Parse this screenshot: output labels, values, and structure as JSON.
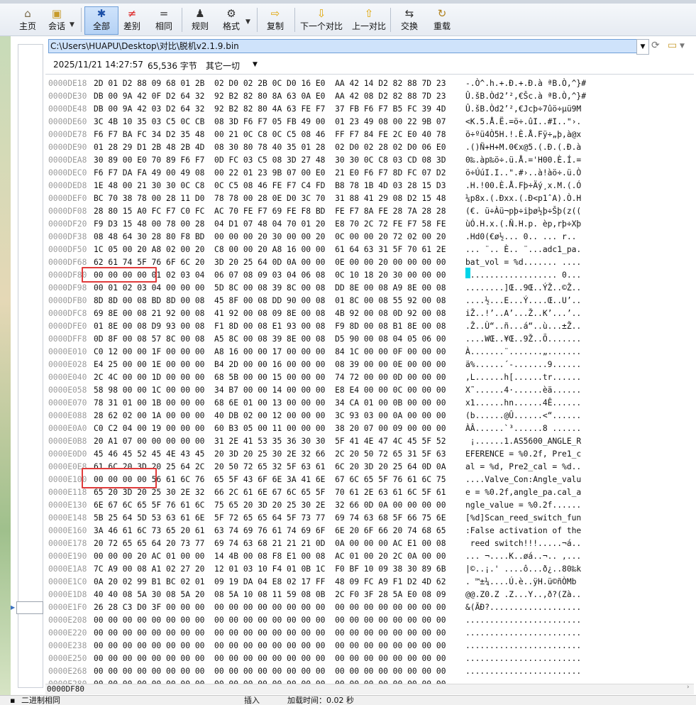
{
  "toolbar": {
    "buttons": [
      {
        "id": "home",
        "label": "主页",
        "icon": "house-icon",
        "glyph": "⌂"
      },
      {
        "id": "session",
        "label": "会话",
        "icon": "briefcase-icon",
        "glyph": "▣"
      },
      {
        "id": "all",
        "label": "全部",
        "icon": "asterisk-icon",
        "glyph": "✱"
      },
      {
        "id": "diff",
        "label": "差别",
        "icon": "not-equal-icon",
        "glyph": "≠"
      },
      {
        "id": "same",
        "label": "相同",
        "icon": "equal-icon",
        "glyph": "="
      },
      {
        "id": "rules",
        "label": "规则",
        "icon": "person-icon",
        "glyph": "♟"
      },
      {
        "id": "format",
        "label": "格式",
        "icon": "gear-icon",
        "glyph": "⚙"
      },
      {
        "id": "copy",
        "label": "复制",
        "icon": "arrow-right-icon",
        "glyph": "⇨"
      },
      {
        "id": "next",
        "label": "下一个对比",
        "icon": "arrow-down-icon",
        "glyph": "⇩"
      },
      {
        "id": "prev",
        "label": "上一对比",
        "icon": "arrow-up-icon",
        "glyph": "⇧"
      },
      {
        "id": "swap",
        "label": "交换",
        "icon": "swap-icon",
        "glyph": "⇆"
      },
      {
        "id": "reload",
        "label": "重载",
        "icon": "reload-icon",
        "glyph": "↻"
      }
    ]
  },
  "path": {
    "value": "C:\\Users\\HUAPU\\Desktop\\对比\\脱机v2.1.9.bin"
  },
  "info": {
    "datetime": "2025/11/21 14:27:57",
    "size": "65,536 字节",
    "other": "其它一切"
  },
  "status": {
    "offset": "0000DF80",
    "mode": "二进制相同",
    "insert": "插入",
    "load_time": "加载时间：0.02 秒"
  },
  "colors": {
    "highlight": "#e03b3b",
    "cursor": "#00d4e8",
    "path_bg": "#cfe3fb"
  },
  "rows": [
    {
      "addr": "0000DE18",
      "hex": "2D 01 D2 88 09 68 01 2B  02 D0 02 2B 0C D0 16 E0  AA 42 14 D2 82 88 7D 23",
      "ascii": "-.Ò^.h.+.Ð.+.Ð.à ªB.Ò,^}#"
    },
    {
      "addr": "0000DE30",
      "hex": "DB 00 9A 42 0F D2 64 32  92 B2 82 80 8A 63 0A E0  AA 42 08 D2 82 88 7D 23",
      "ascii": "Û.šB.Òd2’²,€Šc.à ªB.Ò,^}#"
    },
    {
      "addr": "0000DE48",
      "hex": "DB 00 9A 42 03 D2 64 32  92 B2 82 80 4A 63 FE F7  37 FB F6 F7 B5 FC 39 4D",
      "ascii": "Û.šB.Òd2’²,€Jcþ÷7ûö÷µü9M"
    },
    {
      "addr": "0000DE60",
      "hex": "3C 4B 10 35 03 C5 0C CB  08 3D F6 F7 05 FB 49 00  01 23 49 08 00 22 9B 07",
      "ascii": "<K.5.Å.Ë.=ö÷.ûI..#I..\"›."
    },
    {
      "addr": "0000DE78",
      "hex": "F6 F7 BA FC 34 D2 35 48  00 21 0C C8 0C C5 08 46  FF F7 84 FE 2C E0 40 78",
      "ascii": "ö÷ºü4Ò5H.!.È.Å.Fÿ÷„þ,à@x"
    },
    {
      "addr": "0000DE90",
      "hex": "01 28 29 D1 2B 48 2B 4D  08 30 80 78 40 35 01 28  02 D0 02 28 02 D0 06 E0",
      "ascii": ".()Ñ+H+M.0€x@5.(.Ð.(.Ð.à"
    },
    {
      "addr": "0000DEA8",
      "hex": "30 89 00 E0 70 89 F6 F7  0D FC 03 C5 08 3D 27 48  30 30 0C C8 03 CD 08 3D",
      "ascii": "0‰.àp‰ö÷.ü.Å.='H00.È.Í.="
    },
    {
      "addr": "0000DEC0",
      "hex": "F6 F7 DA FA 49 00 49 08  00 22 01 23 9B 07 00 E0  21 E0 F6 F7 8D FC 07 D2",
      "ascii": "ö÷ÚúI.I..\".#›..à!àö÷.ü.Ò"
    },
    {
      "addr": "0000DED8",
      "hex": "1E 48 00 21 30 30 0C C8  0C C5 08 46 FE F7 C4 FD  B8 78 1B 4D 03 28 15 D3",
      "ascii": ".H.!00.È.Å.Fþ÷Äý¸x.M.(.Ó"
    },
    {
      "addr": "0000DEF0",
      "hex": "BC 70 38 78 00 28 11 D0  78 78 00 28 0E D0 3C 70  31 88 41 29 08 D2 15 48",
      "ascii": "¼p8x.(.Ðxx.(.Ð<p1ˆA).Ò.H"
    },
    {
      "addr": "0000DF08",
      "hex": "28 80 15 A0 FC F7 C0 FC  AC 70 FE F7 69 FE F8 BD  FE F7 8A FE 28 7A 28 28",
      "ascii": "(€. ü÷Àü¬pþ÷iþø½þ÷Šþ(z(("
    },
    {
      "addr": "0000DF20",
      "hex": "F9 D3 15 48 00 78 00 28  04 D1 07 48 04 70 01 20  E8 70 2C 72 FE F7 58 FE",
      "ascii": "ùÓ.H.x.(.Ñ.H.p. èp,rþ÷Xþ"
    },
    {
      "addr": "0000DF38",
      "hex": "08 48 64 30 28 80 F8 BD  00 00 00 20 30 00 00 20  0C 00 00 20 72 02 00 20",
      "ascii": ".Hd0(€ø½... 0.. ... r.. "
    },
    {
      "addr": "0000DF50",
      "hex": "1C 05 00 20 A8 02 00 20  C8 00 00 20 A8 16 00 00  61 64 63 31 5F 70 61 2E",
      "ascii": "... ¨.. È.. ¨...adc1_pa."
    },
    {
      "addr": "0000DF68",
      "hex": "62 61 74 5F 76 6F 6C 20  3D 20 25 64 0D 0A 00 00  0E 00 00 20 00 00 00 00",
      "ascii": "bat_vol = %d....... ...."
    },
    {
      "addr": "0000DF80",
      "hex": "00 00 00 00 01 02 03 04  06 07 08 09 03 04 06 08  0C 10 18 20 30 00 00 00",
      "ascii": "................... 0..."
    },
    {
      "addr": "0000DF98",
      "hex": "00 01 02 03 04 00 00 00  5D 8C 00 08 39 8C 00 08  DD 8E 00 08 A9 8E 00 08",
      "ascii": "........]Œ..9Œ..ÝŽ..©Ž.."
    },
    {
      "addr": "0000DFB0",
      "hex": "8D 8D 00 08 BD 8D 00 08  45 8F 00 08 DD 90 00 08  01 8C 00 08 55 92 00 08",
      "ascii": "....½...E...Ý....Œ..U’.."
    },
    {
      "addr": "0000DFC8",
      "hex": "69 8E 00 08 21 92 00 08  41 92 00 08 09 8E 00 08  4B 92 00 08 0D 92 00 08",
      "ascii": "iŽ..!’..A’...Ž..K’...’.."
    },
    {
      "addr": "0000DFE0",
      "hex": "01 8E 00 08 D9 93 00 08  F1 8D 00 08 E1 93 00 08  F9 8D 00 08 B1 8E 00 08",
      "ascii": ".Ž..Ù“..ñ...á“..ù...±Ž.."
    },
    {
      "addr": "0000DFF8",
      "hex": "0D 8F 00 08 57 8C 00 08  A5 8C 00 08 39 8E 00 08  D5 90 00 08 04 05 06 00",
      "ascii": "....WŒ..¥Œ..9Ž..Õ......."
    },
    {
      "addr": "0000E010",
      "hex": "C0 12 00 00 1F 00 00 00  A8 16 00 00 17 00 00 00  84 1C 00 00 0F 00 00 00",
      "ascii": "À.......¨.......„......."
    },
    {
      "addr": "0000E028",
      "hex": "E4 25 00 00 1E 00 00 00  B4 2D 00 00 16 00 00 00  08 39 00 00 0E 00 00 00",
      "ascii": "ä%......´-.......9......"
    },
    {
      "addr": "0000E040",
      "hex": "2C 4C 00 00 1D 00 00 00  68 5B 00 00 15 00 00 00  74 72 00 00 0D 00 00 00",
      "ascii": ",L......h[......tr......"
    },
    {
      "addr": "0000E058",
      "hex": "58 98 00 00 1C 00 00 00  34 B7 00 00 14 00 00 00  E8 E4 00 00 0C 00 00 00",
      "ascii": "X˜......4·......èä......"
    },
    {
      "addr": "0000E070",
      "hex": "78 31 01 00 1B 00 00 00  68 6E 01 00 13 00 00 00  34 CA 01 00 0B 00 00 00",
      "ascii": "x1......hn......4Ê......"
    },
    {
      "addr": "0000E088",
      "hex": "28 62 02 00 1A 00 00 00  40 DB 02 00 12 00 00 00  3C 93 03 00 0A 00 00 00",
      "ascii": "(b......@Û......<“......"
    },
    {
      "addr": "0000E0A0",
      "hex": "C0 C2 04 00 19 00 00 00  60 B3 05 00 11 00 00 00  38 20 07 00 09 00 00 00",
      "ascii": "ÀÂ......`³......8 ......"
    },
    {
      "addr": "0000E0B8",
      "hex": "20 A1 07 00 00 00 00 00  31 2E 41 53 35 36 30 30  5F 41 4E 47 4C 45 5F 52",
      "ascii": " ¡......1.AS5600_ANGLE_R"
    },
    {
      "addr": "0000E0D0",
      "hex": "45 46 45 52 45 4E 43 45  20 3D 20 25 30 2E 32 66  2C 20 50 72 65 31 5F 63",
      "ascii": "EFERENCE = %0.2f, Pre1_c"
    },
    {
      "addr": "0000E0E8",
      "hex": "61 6C 20 3D 20 25 64 2C  20 50 72 65 32 5F 63 61  6C 20 3D 20 25 64 0D 0A",
      "ascii": "al = %d, Pre2_cal = %d.."
    },
    {
      "addr": "0000E100",
      "hex": "00 00 00 00 56 61 6C 76  65 5F 43 6F 6E 3A 41 6E  67 6C 65 5F 76 61 6C 75",
      "ascii": "....Valve_Con:Angle_valu"
    },
    {
      "addr": "0000E118",
      "hex": "65 20 3D 20 25 30 2E 32  66 2C 61 6E 67 6C 65 5F  70 61 2E 63 61 6C 5F 61",
      "ascii": "e = %0.2f,angle_pa.cal_a"
    },
    {
      "addr": "0000E130",
      "hex": "6E 67 6C 65 5F 76 61 6C  75 65 20 3D 20 25 30 2E  32 66 0D 0A 00 00 00 00",
      "ascii": "ngle_value = %0.2f......"
    },
    {
      "addr": "0000E148",
      "hex": "5B 25 64 5D 53 63 61 6E  5F 72 65 65 64 5F 73 77  69 74 63 68 5F 66 75 6E",
      "ascii": "[%d]Scan_reed_switch_fun"
    },
    {
      "addr": "0000E160",
      "hex": "3A 46 61 6C 73 65 20 61  63 74 69 76 61 74 69 6F  6E 20 6F 66 20 74 68 65",
      "ascii": ":False activation of the"
    },
    {
      "addr": "0000E178",
      "hex": "20 72 65 65 64 20 73 77  69 74 63 68 21 21 21 0D  0A 00 00 00 AC E1 00 08",
      "ascii": " reed switch!!!.....¬á.."
    },
    {
      "addr": "0000E190",
      "hex": "00 00 00 20 AC 01 00 00  14 4B 00 08 F8 E1 00 08  AC 01 00 20 2C 0A 00 00",
      "ascii": "... ¬....K..øá..¬.. ,..."
    },
    {
      "addr": "0000E1A8",
      "hex": "7C A9 00 08 A1 02 27 20  12 01 03 10 F4 01 0B 1C  F0 BF 10 09 38 30 89 6B",
      "ascii": "|©..¡.' ....ô...ð¿..80‰k"
    },
    {
      "addr": "0000E1C0",
      "hex": "0A 20 02 99 B1 BC 02 01  09 19 DA 04 E8 02 17 FF  48 09 FC A9 F1 D2 4D 62",
      "ascii": ". ™±¼....Ú.è..ÿH.ü©ñÒMb"
    },
    {
      "addr": "0000E1D8",
      "hex": "40 40 08 5A 30 08 5A 20  08 5A 10 08 11 59 08 0B  2C F0 3F 28 5A E0 08 09",
      "ascii": "@@.Z0.Z .Z...Y..,ð?(Zà.."
    },
    {
      "addr": "0000E1F0",
      "hex": "26 28 C3 D0 3F 00 00 00  00 00 00 00 00 00 00 00  00 00 00 00 00 00 00 00",
      "ascii": "&(ÃÐ?..................."
    },
    {
      "addr": "0000E208",
      "hex": "00 00 00 00 00 00 00 00  00 00 00 00 00 00 00 00  00 00 00 00 00 00 00 00",
      "ascii": "........................"
    },
    {
      "addr": "0000E220",
      "hex": "00 00 00 00 00 00 00 00  00 00 00 00 00 00 00 00  00 00 00 00 00 00 00 00",
      "ascii": "........................"
    },
    {
      "addr": "0000E238",
      "hex": "00 00 00 00 00 00 00 00  00 00 00 00 00 00 00 00  00 00 00 00 00 00 00 00",
      "ascii": "........................"
    },
    {
      "addr": "0000E250",
      "hex": "00 00 00 00 00 00 00 00  00 00 00 00 00 00 00 00  00 00 00 00 00 00 00 00",
      "ascii": "........................"
    },
    {
      "addr": "0000E268",
      "hex": "00 00 00 00 00 00 00 00  00 00 00 00 00 00 00 00  00 00 00 00 00 00 00 00",
      "ascii": "........................"
    },
    {
      "addr": "0000E280",
      "hex": "00 00 00 00 00 00 00 00  00 00 00 00 00 00 00 00  00 00 00 00 00 00 00 00",
      "ascii": "........................"
    }
  ]
}
